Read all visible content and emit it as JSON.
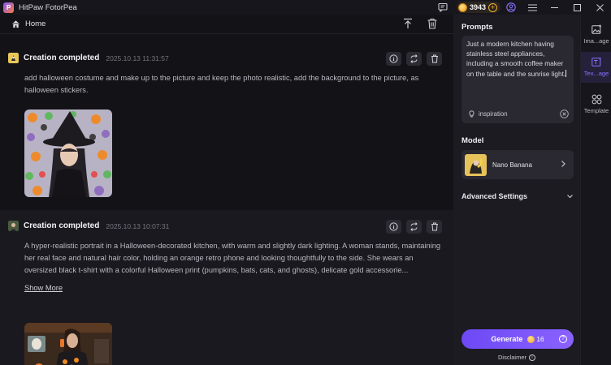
{
  "app": {
    "title": "HitPaw FotorPea",
    "logo_letter": "P"
  },
  "titlebar": {
    "credits": "3943",
    "plus": "+"
  },
  "header": {
    "home_label": "Home"
  },
  "feed": [
    {
      "title": "Creation completed",
      "date": "2025.10.13  11:31:57",
      "text": "add halloween costume and make up to the picture and keep the photo realistic, add the background to the picture, as halloween stickers."
    },
    {
      "title": "Creation completed",
      "date": "2025.10.13  10:07:31",
      "text": "A hyper-realistic portrait in a Halloween-decorated kitchen, with warm and slightly dark lighting. A woman stands, maintaining her real face and natural hair color, holding an orange retro phone and looking thoughtfully to the side. She wears an oversized black t-shirt with a colorful Halloween print (pumpkins, bats, cats, and ghosts), delicate gold accessorie...",
      "show_more": "Show More"
    }
  ],
  "panel": {
    "prompts_label": "Prompts",
    "prompt_text": "Just a modern kitchen having stainless steel appliances, including a smooth coffee maker on the table and the sunrise light.",
    "inspiration": "inspiration",
    "model_label": "Model",
    "model_name": "Nano Banana",
    "advanced_label": "Advanced Settings",
    "generate_label": "Generate",
    "generate_cost": "16",
    "disclaimer": "Disclaimer"
  },
  "rail": [
    {
      "label": "Ima...age",
      "icon": "image-icon",
      "active": false
    },
    {
      "label": "Tex...age",
      "icon": "text-to-image-icon",
      "active": true
    },
    {
      "label": "Template",
      "icon": "template-icon",
      "active": false
    }
  ],
  "colors": {
    "accent": "#7b5cff",
    "coin": "#f0a020"
  }
}
